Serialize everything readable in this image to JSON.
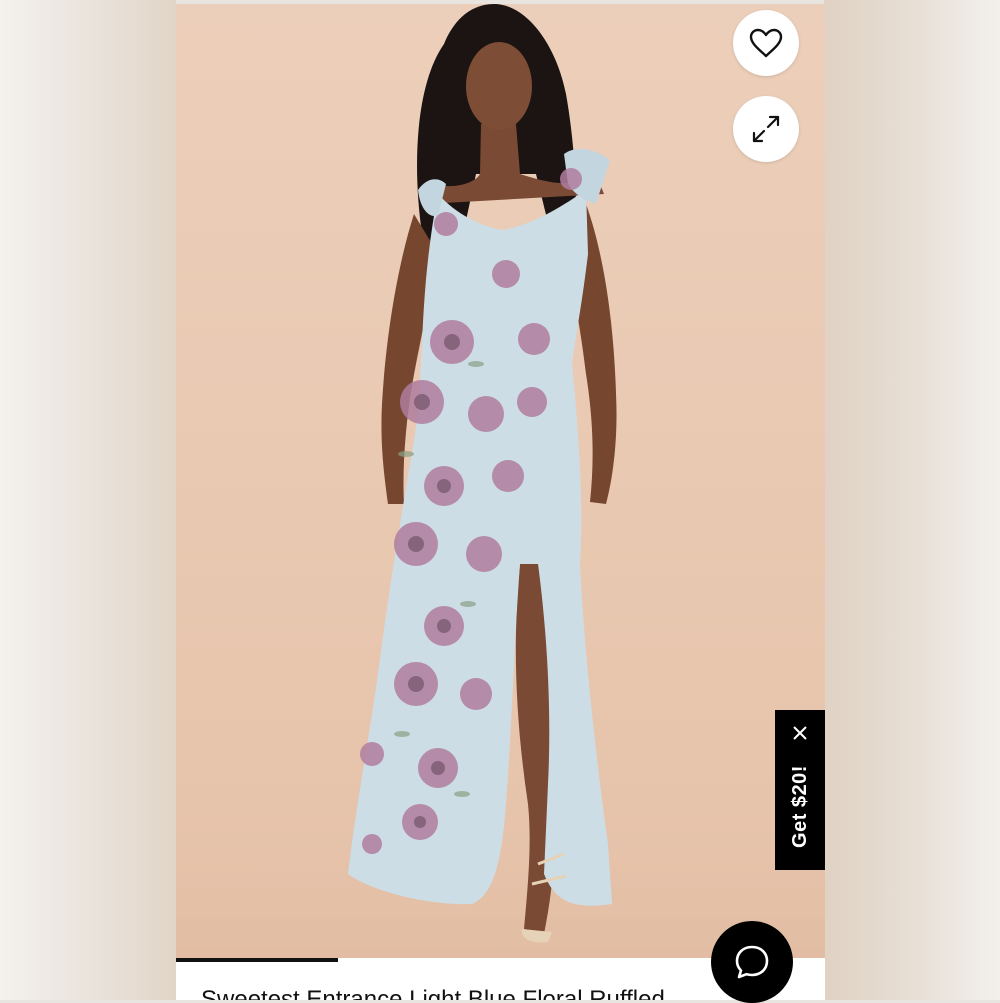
{
  "product": {
    "title": "Sweetest Entrance Light Blue Floral Ruffled",
    "image_alt": "Model wearing light blue floral ruffled maxi dress",
    "gallery_progress_percent": 25
  },
  "actions": {
    "wishlist_icon": "heart-outline-icon",
    "expand_icon": "expand-arrows-icon"
  },
  "promo": {
    "label": "Get $20!",
    "close_icon": "close-icon"
  },
  "chat": {
    "icon": "chat-bubble-icon"
  },
  "colors": {
    "photo_background": "#e9c8b1",
    "dress": "#cddde6",
    "flower": "#b07d9f",
    "promo_background": "#000000",
    "chat_background": "#000000"
  }
}
